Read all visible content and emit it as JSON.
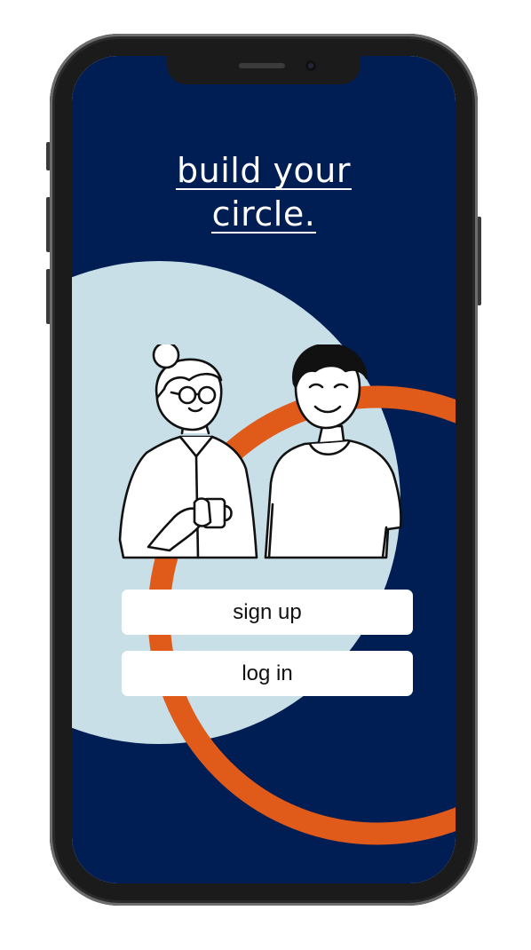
{
  "welcome": {
    "headline_line1": "build your",
    "headline_line2": "circle.",
    "signup_label": "sign up",
    "login_label": "log in"
  },
  "theme": {
    "background": "#001d54",
    "accent_circle": "#c8dfe8",
    "ring": "#e05a1a",
    "button": "#ffffff",
    "button_text": "#111111"
  },
  "illustration": {
    "subject": "two people chatting",
    "icons": [
      "woman-with-mug-illustration",
      "man-illustration"
    ]
  }
}
